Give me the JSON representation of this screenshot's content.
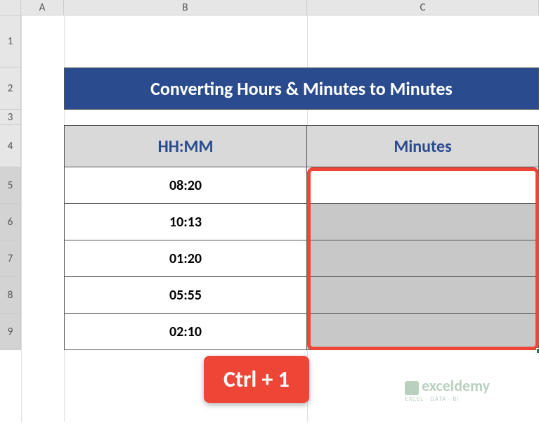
{
  "columns": {
    "A": "A",
    "B": "B",
    "C": "C"
  },
  "rows": {
    "r1": "1",
    "r2": "2",
    "r3": "3",
    "r4": "4",
    "r5": "5",
    "r6": "6",
    "r7": "7",
    "r8": "8",
    "r9": "9"
  },
  "title": "Converting Hours & Minutes to Minutes",
  "headers": {
    "b": "HH:MM",
    "c": "Minutes"
  },
  "data": {
    "r5": {
      "b": "08:20",
      "c": ""
    },
    "r6": {
      "b": "10:13",
      "c": ""
    },
    "r7": {
      "b": "01:20",
      "c": ""
    },
    "r8": {
      "b": "05:55",
      "c": ""
    },
    "r9": {
      "b": "02:10",
      "c": ""
    }
  },
  "callout": "Ctrl + 1",
  "watermark": {
    "main": "exceldemy",
    "sub": "EXCEL · DATA · BI"
  },
  "chart_data": {
    "type": "table",
    "title": "Converting Hours & Minutes to Minutes",
    "columns": [
      "HH:MM",
      "Minutes"
    ],
    "rows": [
      {
        "HH:MM": "08:20",
        "Minutes": null
      },
      {
        "HH:MM": "10:13",
        "Minutes": null
      },
      {
        "HH:MM": "01:20",
        "Minutes": null
      },
      {
        "HH:MM": "05:55",
        "Minutes": null
      },
      {
        "HH:MM": "02:10",
        "Minutes": null
      }
    ],
    "selection": "C5:C9",
    "shortcut_hint": "Ctrl + 1"
  }
}
